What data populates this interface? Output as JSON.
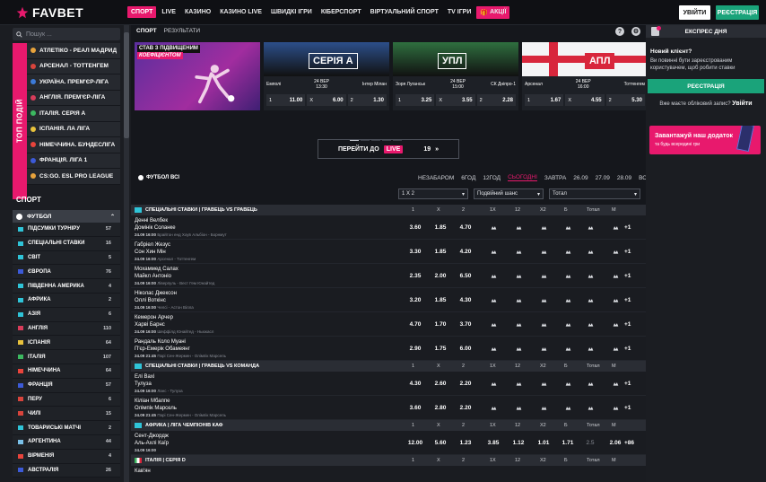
{
  "header": {
    "logo": "FAVBET",
    "nav": [
      "СПОРТ",
      "LIVE",
      "КАЗИНО",
      "КАЗИНО LIVE",
      "ШВИДКІ ІГРИ",
      "КІБЕРСПОРТ",
      "ВІРТУАЛЬНИЙ СПОРТ",
      "TV ІГРИ",
      "АКЦІЇ"
    ],
    "login": "УВІЙТИ",
    "register": "РЕЄСТРАЦІЯ"
  },
  "sidebar": {
    "search_placeholder": "Пошук ...",
    "top_label": "ТОП ПОДІЙ",
    "top_items": [
      {
        "label": "АТЛЕТІКО - РЕАЛ МАДРИД",
        "color": "#e8a33c"
      },
      {
        "label": "АРСЕНАЛ - ТОТТЕНГЕМ",
        "color": "#d8443c"
      },
      {
        "label": "УКРАЇНА. ПРЕМ'ЄР-ЛІГА",
        "color": "#3c7ad8"
      },
      {
        "label": "АНГЛІЯ. ПРЕМ'ЄР-ЛІГА",
        "color": "#d83c5a"
      },
      {
        "label": "ІТАЛІЯ. СЕРІЯ А",
        "color": "#3cb860"
      },
      {
        "label": "ІСПАНІЯ. ЛА ЛІГА",
        "color": "#e8c23c"
      },
      {
        "label": "НІМЕЧЧИНА. БУНДЕСЛІГА",
        "color": "#e8443c"
      },
      {
        "label": "ФРАНЦІЯ. ЛІГА 1",
        "color": "#3c5ad8"
      },
      {
        "label": "CS:GO. ESL PRO LEAGUE",
        "color": "#e8a33c"
      }
    ],
    "sport_heading": "СПОРТ",
    "sport_active": "ФУТБОЛ",
    "sports": [
      {
        "label": "ПІДСУМКИ ТУРНІРУ",
        "count": "57",
        "color": "#2fc4d8"
      },
      {
        "label": "СПЕЦІАЛЬНІ СТАВКИ",
        "count": "16",
        "color": "#2fc4d8"
      },
      {
        "label": "СВІТ",
        "count": "5",
        "color": "#2fc4d8"
      },
      {
        "label": "ЄВРОПА",
        "count": "76",
        "color": "#3c5ad8"
      },
      {
        "label": "ПІВДЕННА АМЕРИКА",
        "count": "4",
        "color": "#2fc4d8"
      },
      {
        "label": "АФРИКА",
        "count": "2",
        "color": "#2fc4d8"
      },
      {
        "label": "АЗІЯ",
        "count": "6",
        "color": "#2fc4d8"
      },
      {
        "label": "АНГЛІЯ",
        "count": "110",
        "color": "#d83c5a"
      },
      {
        "label": "ІСПАНІЯ",
        "count": "64",
        "color": "#e8c23c"
      },
      {
        "label": "ІТАЛІЯ",
        "count": "107",
        "color": "#3cb860"
      },
      {
        "label": "НІМЕЧЧИНА",
        "count": "64",
        "color": "#e8443c"
      },
      {
        "label": "ФРАНЦІЯ",
        "count": "57",
        "color": "#3c5ad8"
      },
      {
        "label": "ПЕРУ",
        "count": "6",
        "color": "#d8443c"
      },
      {
        "label": "ЧИЛІ",
        "count": "15",
        "color": "#d8443c"
      },
      {
        "label": "ТОВАРИСЬКІ МАТЧІ",
        "count": "2",
        "color": "#2fc4d8"
      },
      {
        "label": "АРГЕНТИНА",
        "count": "44",
        "color": "#7ac0e8"
      },
      {
        "label": "ВІРМЕНІЯ",
        "count": "4",
        "color": "#e8443c"
      },
      {
        "label": "АВСТРАЛІЯ",
        "count": "26",
        "color": "#3c5ad8"
      }
    ]
  },
  "main": {
    "tabs": [
      "СПОРТ",
      "РЕЗУЛЬТАТИ"
    ],
    "promo_banner": {
      "line1": "СТАВ З ПІДВИЩЕНИМ",
      "line2": "КОЕФІЦІЄНТОМ"
    },
    "match_banners": [
      {
        "label": "СЕРІЯ А",
        "home": "Емполі",
        "date": "24 ВЕР",
        "time": "13:30",
        "away": "Інтер Мілан",
        "odds": [
          {
            "k": "1",
            "v": "11.00"
          },
          {
            "k": "X",
            "v": "6.00"
          },
          {
            "k": "2",
            "v": "1.30"
          }
        ],
        "bg": "#2c4f8a"
      },
      {
        "label": "УПЛ",
        "home": "Зоря Луганськ",
        "date": "24 ВЕР",
        "time": "15:00",
        "away": "СК Дніпро-1",
        "odds": [
          {
            "k": "1",
            "v": "3.25"
          },
          {
            "k": "X",
            "v": "3.55"
          },
          {
            "k": "2",
            "v": "2.28"
          }
        ],
        "bg": "#2f6f3f"
      },
      {
        "label": "АПЛ",
        "home": "Арсенал",
        "date": "24 ВЕР",
        "time": "16:00",
        "away": "Тоттенгем",
        "odds": [
          {
            "k": "1",
            "v": "1.67"
          },
          {
            "k": "X",
            "v": "4.55"
          },
          {
            "k": "2",
            "v": "5.30"
          }
        ],
        "bg": "#e9e9ec"
      }
    ],
    "live_button": {
      "label": "ПЕРЕЙТИ ДО",
      "badge": "LIVE",
      "count": "19"
    },
    "football_title": "ФУТБОЛ ВСІ",
    "time_tabs": [
      "НЕЗАБАРОМ",
      "6ГОД",
      "12ГОД",
      "СЬОГОДНІ",
      "ЗАВТРА",
      "26.09",
      "27.09",
      "28.09",
      "ВСІ"
    ],
    "active_time_tab": "СЬОГОДНІ",
    "selects": [
      "1 X 2",
      "Подвійний шанс",
      "Тотал"
    ],
    "columns": [
      "1",
      "X",
      "2",
      "1X",
      "12",
      "X2",
      "Б",
      "Тотал",
      "М"
    ],
    "leagues": [
      {
        "name": "СПЕЦІАЛЬНІ СТАВКИ | ГРАВЕЦЬ VS ГРАВЕЦЬ",
        "matches": [
          {
            "t1": "Денні Велбек",
            "t2": "Домінік Соланке",
            "date": "24.09",
            "time": "16:00",
            "info": "Брайтон енд Хоув Альбіон - Борнмут",
            "odds": [
              "3.60",
              "1.85",
              "4.70"
            ],
            "extra": "+1"
          },
          {
            "t1": "Габріел Жезус",
            "t2": "Сон Хин Мін",
            "date": "24.09",
            "time": "16:00",
            "info": "Арсенал - Тоттенгем",
            "odds": [
              "3.30",
              "1.85",
              "4.20"
            ],
            "extra": "+1"
          },
          {
            "t1": "Мохаммед Салах",
            "t2": "Майкл Антоніо",
            "date": "24.09",
            "time": "16:00",
            "info": "Ліверпуль - Вест Гем Юнайтед",
            "odds": [
              "2.35",
              "2.00",
              "6.50"
            ],
            "extra": "+1"
          },
          {
            "t1": "Ніколас Джексон",
            "t2": "Оллі Воткінс",
            "date": "24.09",
            "time": "16:00",
            "info": "Челсі - Астон Вілла",
            "odds": [
              "3.20",
              "1.85",
              "4.30"
            ],
            "extra": "+1"
          },
          {
            "t1": "Кемерон Арчер",
            "t2": "Харві Барнс",
            "date": "24.09",
            "time": "16:00",
            "info": "Шеффілд Юнайтед - Ньюкасл",
            "odds": [
              "4.70",
              "1.70",
              "3.70"
            ],
            "extra": "+1"
          },
          {
            "t1": "Рандаль Коло Муані",
            "t2": "П'єр-Емерік Обамеянг",
            "date": "24.09",
            "time": "21:45",
            "info": "Парі Сен-Жермен - Олімпік Марсель",
            "odds": [
              "2.90",
              "1.75",
              "6.00"
            ],
            "extra": "+1"
          }
        ]
      },
      {
        "name": "СПЕЦІАЛЬНІ СТАВКИ | ГРАВЕЦЬ VS КОМАНДА",
        "matches": [
          {
            "t1": "Елі Вахі",
            "t2": "Тулуза",
            "date": "24.09",
            "time": "16:00",
            "info": "Ланс - Тулуза",
            "odds": [
              "4.30",
              "2.60",
              "2.20"
            ],
            "extra": "+1"
          },
          {
            "t1": "Кіліан Мбаппе",
            "t2": "Олімпік Марсель",
            "date": "24.09",
            "time": "21:45",
            "info": "Парі Сен-Жермен - Олімпік Марсель",
            "odds": [
              "3.60",
              "2.80",
              "2.20"
            ],
            "extra": "+1"
          }
        ]
      },
      {
        "name": "АФРИКА | ЛІГА ЧЕМПІОНІВ КАФ",
        "matches": [
          {
            "t1": "Сент-Джордж",
            "t2": "Аль-Ахлі Каїр",
            "date": "24.09",
            "time": "16:00",
            "info": "",
            "odds": [
              "12.00",
              "5.60",
              "1.23",
              "3.85",
              "1.12",
              "1.01",
              "1.71",
              "2.5",
              "2.06"
            ],
            "extra": "+86"
          }
        ]
      },
      {
        "name": "ІТАЛІЯ | СЕРІЯ D",
        "matches": [
          {
            "t1": "Кав'ян",
            "t2": "",
            "date": "",
            "time": "",
            "info": "",
            "odds": [],
            "extra": ""
          }
        ]
      }
    ]
  },
  "right": {
    "slip": "ЕКСПРЕС ДНЯ",
    "heading": "Новий клієнт?",
    "text": "Ви повинні бути зареєстрованим користувачем, щоб робити ставки",
    "register": "РЕЄСТРАЦІЯ",
    "login_q": "Вже маєте обліковий запис?",
    "login": "Увійти",
    "app_title": "Завантажуй наш додаток",
    "app_sub": "та будь всередині гри"
  }
}
